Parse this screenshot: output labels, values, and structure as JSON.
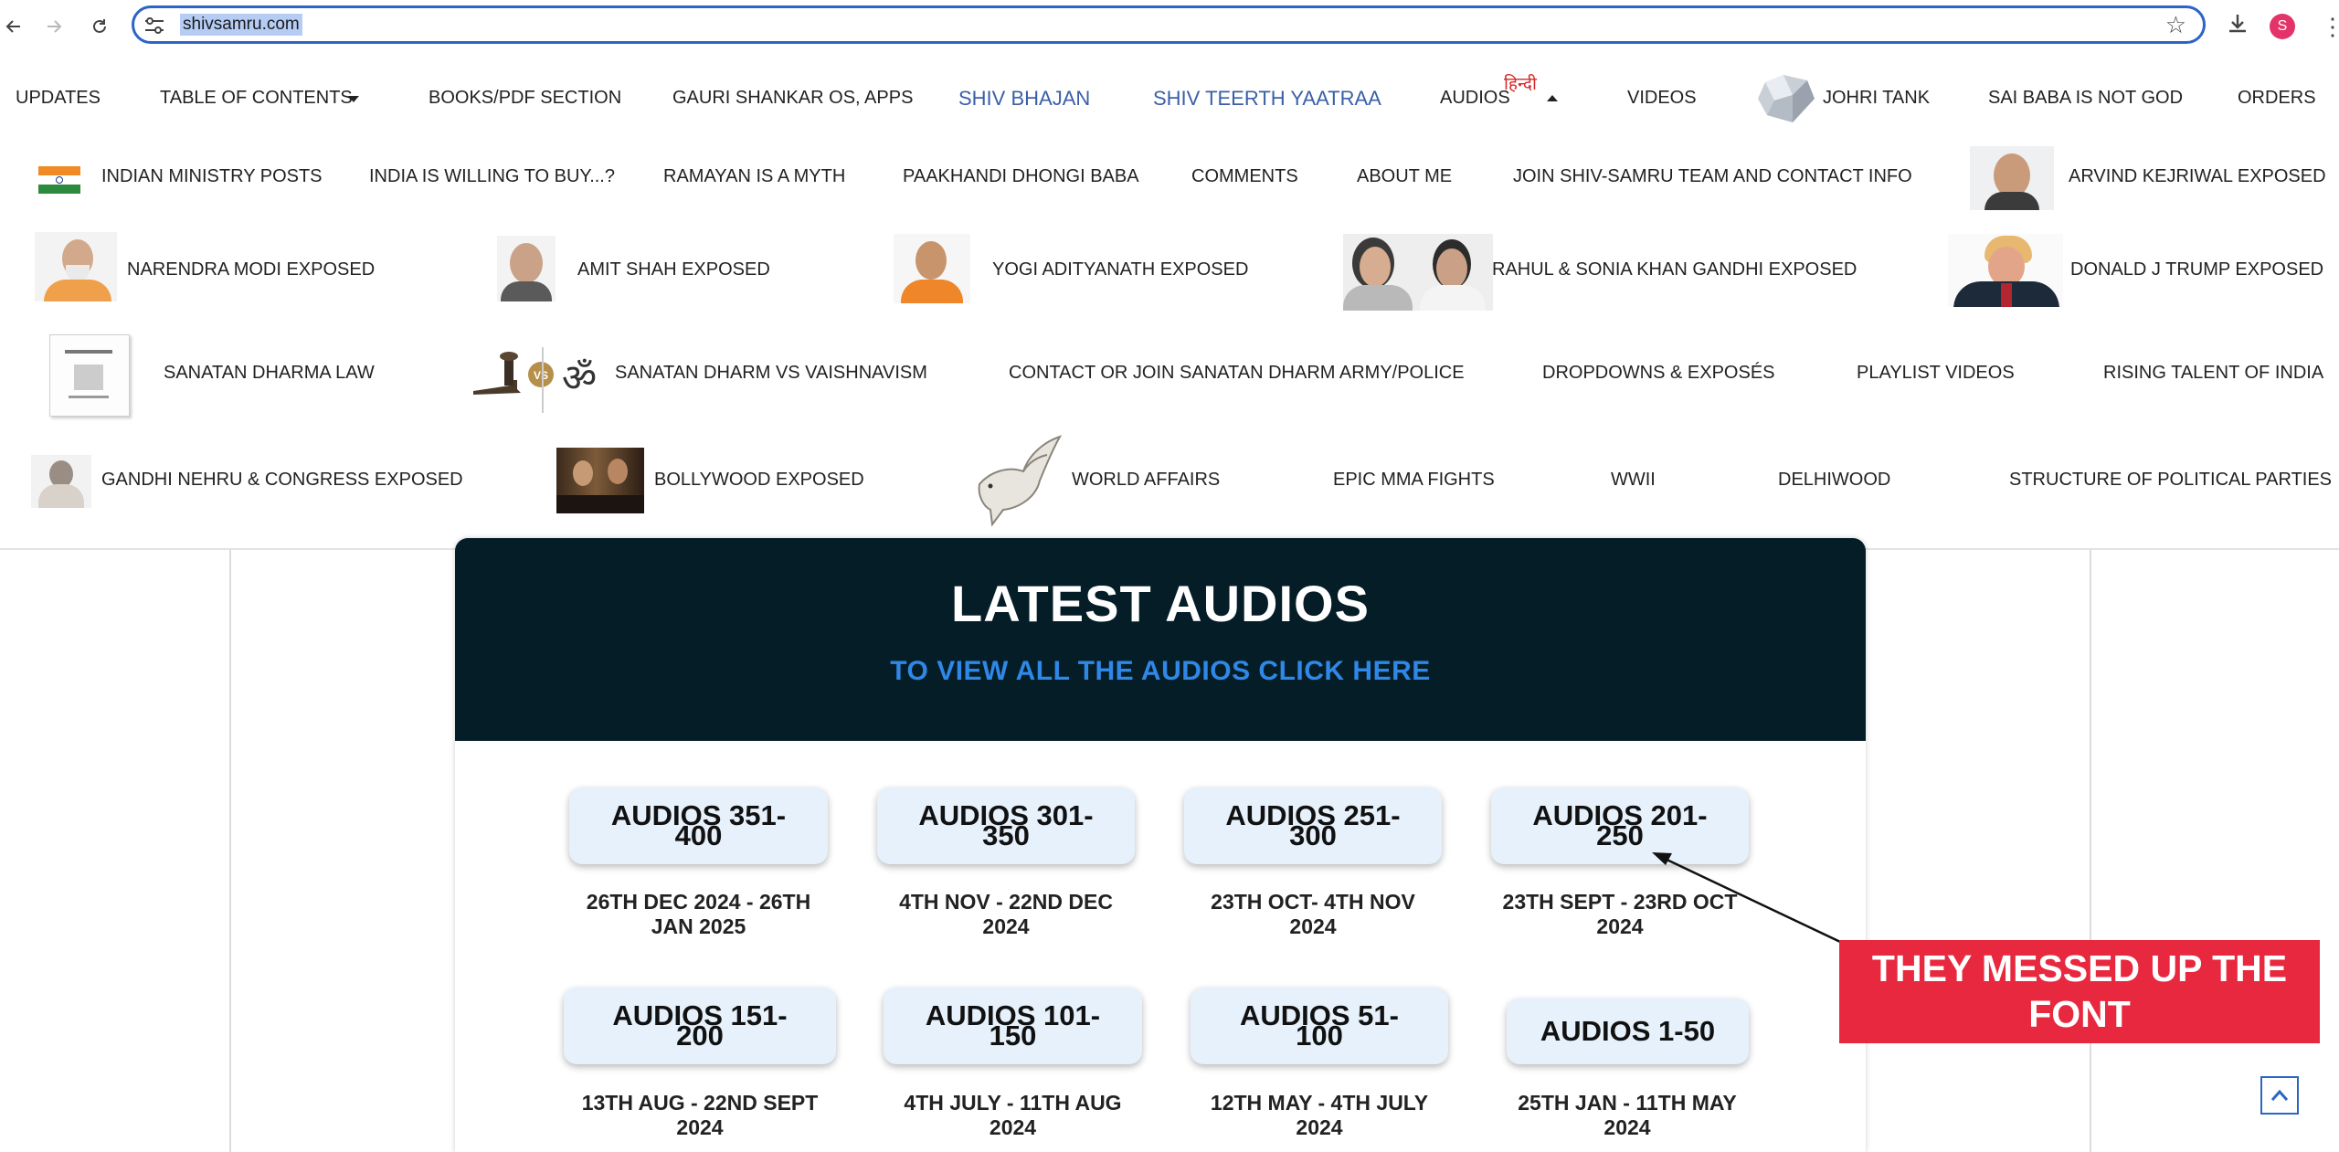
{
  "browser": {
    "url": "shivsamru.com",
    "avatar_letter": "S"
  },
  "nav": {
    "row1": [
      "UPDATES",
      "TABLE OF CONTENTS",
      "BOOKS/PDF SECTION",
      "GAURI SHANKAR OS, APPS",
      "SHIV BHAJAN",
      "SHIV TEERTH YAATRAA",
      "AUDIOS",
      "VIDEOS",
      "JOHRI TANK",
      "SAI BABA IS NOT GOD",
      "ORDERS"
    ],
    "hindi_badge": "हिन्दी",
    "row2": [
      "INDIAN MINISTRY POSTS",
      "INDIA IS WILLING TO BUY...?",
      "RAMAYAN IS A MYTH",
      "PAAKHANDI DHONGI BABA",
      "COMMENTS",
      "ABOUT ME",
      "JOIN SHIV-SAMRU TEAM AND CONTACT INFO",
      "ARVIND KEJRIWAL EXPOSED"
    ],
    "row3": [
      "NARENDRA MODI EXPOSED",
      "AMIT SHAH EXPOSED",
      "YOGI ADITYANATH EXPOSED",
      "RAHUL & SONIA KHAN GANDHI EXPOSED",
      "DONALD J TRUMP EXPOSED"
    ],
    "row4": [
      "SANATAN DHARMA LAW",
      "SANATAN DHARM VS VAISHNAVISM",
      "CONTACT OR JOIN SANATAN DHARM ARMY/POLICE",
      "DROPDOWNS & EXPOSÉS",
      "PLAYLIST VIDEOS",
      "RISING TALENT OF INDIA"
    ],
    "vs_badge": "VS",
    "row5": [
      "GANDHI NEHRU & CONGRESS EXPOSED",
      "BOLLYWOOD EXPOSED",
      "WORLD AFFAIRS",
      "EPIC MMA FIGHTS",
      "WWII",
      "DELHIWOOD",
      "STRUCTURE OF POLITICAL PARTIES"
    ]
  },
  "latest": {
    "title": "LATEST AUDIOS",
    "view_all": "TO VIEW ALL THE AUDIOS CLICK HERE",
    "items": [
      {
        "l1": "AUDIOS 351-",
        "l2": "400",
        "d1": "26TH DEC 2024 - 26TH",
        "d2": "JAN 2025"
      },
      {
        "l1": "AUDIOS 301-",
        "l2": "350",
        "d1": "4TH NOV - 22ND DEC",
        "d2": "2024"
      },
      {
        "l1": "AUDIOS 251-",
        "l2": "300",
        "d1": "23TH OCT- 4TH NOV",
        "d2": "2024"
      },
      {
        "l1": "AUDIOS 201-",
        "l2": "250",
        "d1": "23TH SEPT - 23RD OCT",
        "d2": "2024"
      },
      {
        "l1": "AUDIOS 151-",
        "l2": "200",
        "d1": "13TH AUG - 22ND SEPT",
        "d2": "2024"
      },
      {
        "l1": "AUDIOS 101-",
        "l2": "150",
        "d1": "4TH JULY - 11TH AUG",
        "d2": "2024"
      },
      {
        "l1": "AUDIOS 51-",
        "l2": "100",
        "d1": "12TH MAY - 4TH JULY",
        "d2": "2024"
      },
      {
        "l1": "AUDIOS 1-50",
        "l2": "",
        "d1": "25TH JAN - 11TH MAY",
        "d2": "2024"
      }
    ]
  },
  "annotation": {
    "line1": "THEY MESSED UP THE",
    "line2": "FONT"
  },
  "colors": {
    "header_bg": "#041d27",
    "link_blue": "#2f87e6",
    "callout_red": "#e8283f",
    "button_bg": "#e6f1fc"
  }
}
